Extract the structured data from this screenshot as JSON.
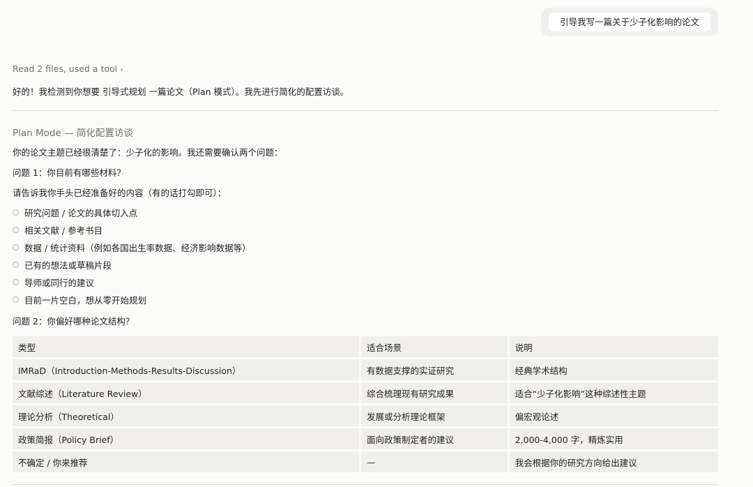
{
  "user_message": "引导我写一篇关于少子化影响的论文",
  "tool_summary": {
    "text": "Read 2 files, used a tool",
    "chevron": "›"
  },
  "assistant_ack": "好的！我检测到你想要 引导式规划 一篇论文（Plan 模式）。我先进行简化的配置访谈。",
  "plan": {
    "title": "Plan Mode — 简化配置访谈",
    "intro": "你的论文主题已经很清楚了：少子化的影响。我还需要确认两个问题：",
    "q1": {
      "title": "问题 1：你目前有哪些材料？",
      "prompt": "请告诉我你手头已经准备好的内容（有的话打勾即可）：",
      "options": [
        "研究问题 / 论文的具体切入点",
        "相关文献 / 参考书目",
        "数据 / 统计资料（例如各国出生率数据、经济影响数据等）",
        "已有的想法或草稿片段",
        "导师或同行的建议",
        "目前一片空白，想从零开始规划"
      ]
    },
    "q2": {
      "title": "问题 2：你偏好哪种论文结构？",
      "table": {
        "headers": [
          "类型",
          "适合场景",
          "说明"
        ],
        "rows": [
          [
            "IMRaD（Introduction-Methods-Results-Discussion）",
            "有数据支撑的实证研究",
            "经典学术结构"
          ],
          [
            "文献综述（Literature Review）",
            "综合梳理现有研究成果",
            "适合“少子化影响”这种综述性主题"
          ],
          [
            "理论分析（Theoretical）",
            "发展或分析理论框架",
            "偏宏观论述"
          ],
          [
            "政策简报（Policy Brief）",
            "面向政策制定者的建议",
            "2,000-4,000 字，精炼实用"
          ],
          [
            "不确定 / 你来推荐",
            "—",
            "我会根据你的研究方向给出建议"
          ]
        ]
      }
    }
  }
}
